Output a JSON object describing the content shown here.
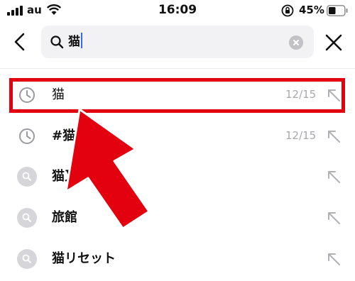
{
  "status_bar": {
    "carrier": "au",
    "time": "16:09",
    "battery_percent": "45%",
    "battery_level": 0.45
  },
  "search": {
    "query": "猫",
    "back_icon": "chevron-left-icon",
    "clear_icon": "clear-circle-icon",
    "close_icon": "close-icon"
  },
  "results": [
    {
      "type": "history",
      "icon": "clock-icon",
      "label": "猫",
      "date": "12/15"
    },
    {
      "type": "history",
      "icon": "clock-icon",
      "label": "#猫",
      "date": "12/15"
    },
    {
      "type": "suggestion",
      "icon": "search-icon",
      "label": "猫又おか",
      "date": ""
    },
    {
      "type": "suggestion",
      "icon": "search-icon",
      "label": "旅館",
      "date": ""
    },
    {
      "type": "suggestion",
      "icon": "search-icon",
      "label": "猫リセット",
      "date": ""
    }
  ],
  "annotation": {
    "highlight_color": "#e3000f",
    "arrow_color": "#e3000f"
  }
}
